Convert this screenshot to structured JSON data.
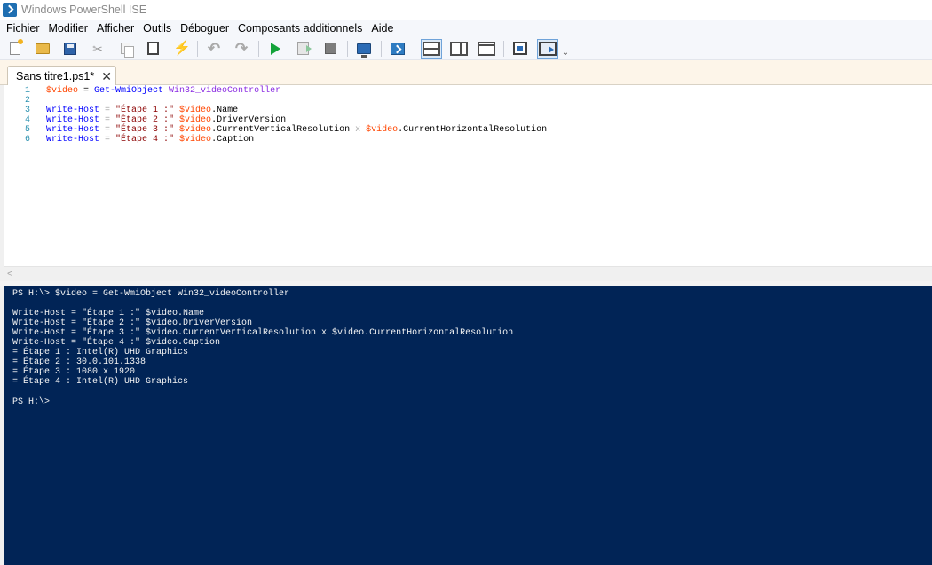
{
  "window": {
    "title": "Windows PowerShell ISE"
  },
  "menu": [
    {
      "name": "menu-fichier",
      "label": "Fichier"
    },
    {
      "name": "menu-modifier",
      "label": "Modifier"
    },
    {
      "name": "menu-afficher",
      "label": "Afficher"
    },
    {
      "name": "menu-outils",
      "label": "Outils"
    },
    {
      "name": "menu-deboguer",
      "label": "Déboguer"
    },
    {
      "name": "menu-composants",
      "label": "Composants additionnels"
    },
    {
      "name": "menu-aide",
      "label": "Aide"
    }
  ],
  "toolbar": {
    "icons": [
      "new-script-icon",
      "open-icon",
      "save-icon",
      "cut-icon",
      "copy-icon",
      "paste-icon",
      "clear-console-icon",
      "undo-icon",
      "redo-icon",
      "run-script-icon",
      "run-selection-icon",
      "stop-icon",
      "new-remote-tab-icon",
      "start-powershell-icon",
      "show-script-pane-top-icon",
      "show-script-pane-right-icon",
      "show-script-pane-maximized-icon",
      "show-commands-window-icon",
      "show-commands-addon-icon"
    ],
    "more_glyph": "⌄",
    "cut_glyph": "✂",
    "clear_glyph": "⚡",
    "undo_glyph": "↶",
    "redo_glyph": "↷"
  },
  "tabs": [
    {
      "label": "Sans titre1.ps1*",
      "close_glyph": "✕"
    }
  ],
  "editor": {
    "lines": [
      {
        "num": "1",
        "tokens": [
          {
            "t": "$video",
            "c": "var"
          },
          {
            "t": " = ",
            "c": "mem"
          },
          {
            "t": "Get-WmiObject",
            "c": "cmd"
          },
          {
            "t": " Win32_videoController",
            "c": "arg"
          }
        ]
      },
      {
        "num": "2",
        "tokens": []
      },
      {
        "num": "3",
        "tokens": [
          {
            "t": "Write-Host",
            "c": "cmd"
          },
          {
            "t": " = ",
            "c": "op"
          },
          {
            "t": "\"Étape 1 :\"",
            "c": "str"
          },
          {
            "t": " $video",
            "c": "var"
          },
          {
            "t": ".Name",
            "c": "mem"
          }
        ]
      },
      {
        "num": "4",
        "tokens": [
          {
            "t": "Write-Host",
            "c": "cmd"
          },
          {
            "t": " = ",
            "c": "op"
          },
          {
            "t": "\"Étape 2 :\"",
            "c": "str"
          },
          {
            "t": " $video",
            "c": "var"
          },
          {
            "t": ".DriverVersion",
            "c": "mem"
          }
        ]
      },
      {
        "num": "5",
        "tokens": [
          {
            "t": "Write-Host",
            "c": "cmd"
          },
          {
            "t": " = ",
            "c": "op"
          },
          {
            "t": "\"Étape 3 :\"",
            "c": "str"
          },
          {
            "t": " $video",
            "c": "var"
          },
          {
            "t": ".CurrentVerticalResolution",
            "c": "mem"
          },
          {
            "t": " x ",
            "c": "op"
          },
          {
            "t": "$video",
            "c": "var"
          },
          {
            "t": ".CurrentHorizontalResolution",
            "c": "mem"
          }
        ]
      },
      {
        "num": "6",
        "tokens": [
          {
            "t": "Write-Host",
            "c": "cmd"
          },
          {
            "t": " = ",
            "c": "op"
          },
          {
            "t": "\"Étape 4 :\"",
            "c": "str"
          },
          {
            "t": " $video",
            "c": "var"
          },
          {
            "t": ".Caption",
            "c": "mem"
          }
        ]
      }
    ],
    "scroll_left_glyph": "<"
  },
  "console": {
    "lines": [
      "PS H:\\> $video = Get-WmiObject Win32_videoController",
      "",
      "Write-Host = \"Étape 1 :\" $video.Name",
      "Write-Host = \"Étape 2 :\" $video.DriverVersion",
      "Write-Host = \"Étape 3 :\" $video.CurrentVerticalResolution x $video.CurrentHorizontalResolution",
      "Write-Host = \"Étape 4 :\" $video.Caption",
      "= Étape 1 : Intel(R) UHD Graphics",
      "= Étape 2 : 30.0.101.1338",
      "= Étape 3 : 1080 x 1920",
      "= Étape 4 : Intel(R) UHD Graphics",
      "",
      "PS H:\\>"
    ]
  },
  "colors": {
    "console_bg": "#012456",
    "variable": "#ff4500",
    "command": "#0000ff",
    "string": "#8b0000",
    "argument": "#8a2be2",
    "operator": "#a9a9a9",
    "line_number": "#2b91af"
  }
}
